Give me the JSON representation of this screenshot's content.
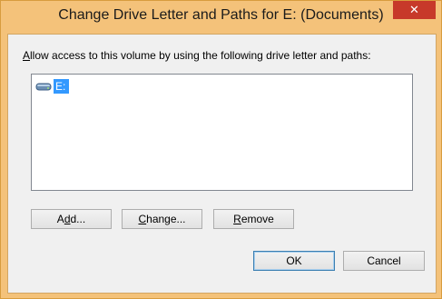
{
  "window": {
    "title": "Change Drive Letter and Paths for E: (Documents)",
    "close_glyph": "✕",
    "accent_color": "#f4c27a",
    "close_color": "#c7392a"
  },
  "instructions": {
    "accel": "A",
    "rest": "llow access to this volume by using the following drive letter and paths:"
  },
  "list": {
    "items": [
      {
        "icon": "drive-icon",
        "label": "E:",
        "selected": true
      }
    ],
    "selection_color": "#3399ff"
  },
  "buttons": {
    "add": {
      "accel": "d",
      "pre": "A",
      "post": "d..."
    },
    "change": {
      "accel": "C",
      "pre": "",
      "post": "hange..."
    },
    "remove": {
      "accel": "R",
      "pre": "",
      "post": "emove"
    },
    "ok": "OK",
    "cancel": "Cancel"
  }
}
